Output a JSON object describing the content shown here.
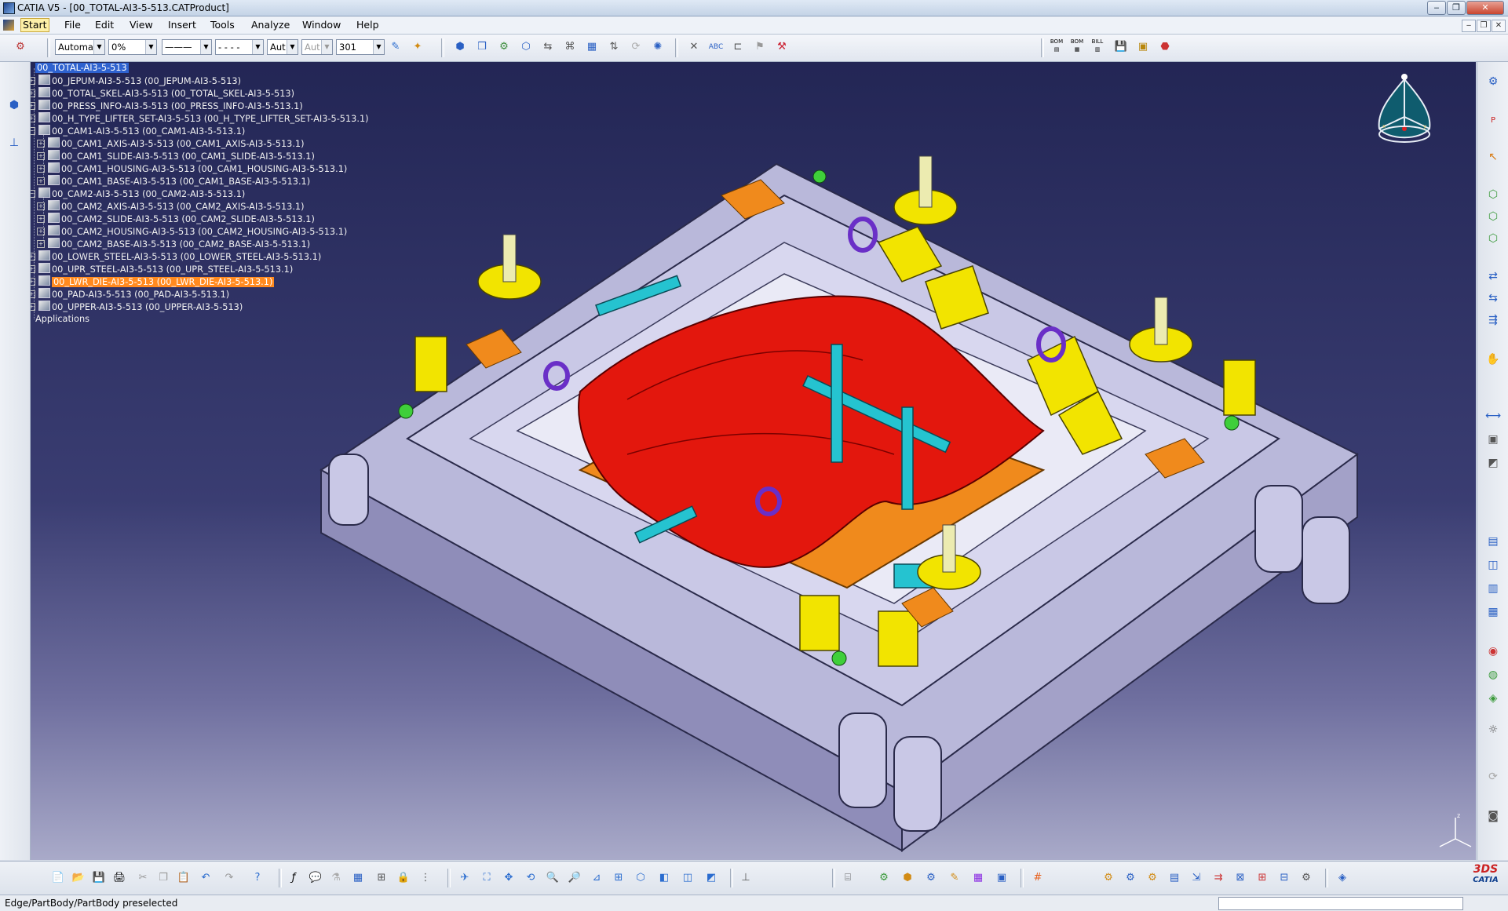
{
  "window": {
    "title": "CATIA V5 - [00_TOTAL-AI3-5-513.CATProduct]",
    "controls": [
      "‒",
      "❐",
      "✕"
    ],
    "mdi_controls": [
      "‒",
      "❐",
      "✕"
    ]
  },
  "menubar": {
    "items": [
      "Start",
      "File",
      "Edit",
      "View",
      "Insert",
      "Tools",
      "Analyze",
      "Window",
      "Help"
    ]
  },
  "toolbar": {
    "combo_color": "Automa",
    "combo_transparency": "0%",
    "combo_linetype": "———",
    "combo_lineweight": "- - - -",
    "combo_layer": "Aut",
    "combo_layer2": "Aut",
    "combo_number": "301",
    "group_labels": [
      "BOM",
      "BOM",
      "BILL"
    ]
  },
  "tree": {
    "nodes": [
      {
        "label": "00_TOTAL-AI3-5-513",
        "level": 0,
        "state": "root"
      },
      {
        "label": "00_JEPUM-AI3-5-513 (00_JEPUM-AI3-5-513)",
        "level": 1,
        "state": ""
      },
      {
        "label": "00_TOTAL_SKEL-AI3-5-513 (00_TOTAL_SKEL-AI3-5-513)",
        "level": 1,
        "state": ""
      },
      {
        "label": "00_PRESS_INFO-AI3-5-513 (00_PRESS_INFO-AI3-5-513.1)",
        "level": 1,
        "state": ""
      },
      {
        "label": "00_H_TYPE_LIFTER_SET-AI3-5-513 (00_H_TYPE_LIFTER_SET-AI3-5-513.1)",
        "level": 1,
        "state": ""
      },
      {
        "label": "00_CAM1-AI3-5-513 (00_CAM1-AI3-5-513.1)",
        "level": 1,
        "state": "open"
      },
      {
        "label": "00_CAM1_AXIS-AI3-5-513 (00_CAM1_AXIS-AI3-5-513.1)",
        "level": 2,
        "state": ""
      },
      {
        "label": "00_CAM1_SLIDE-AI3-5-513 (00_CAM1_SLIDE-AI3-5-513.1)",
        "level": 2,
        "state": ""
      },
      {
        "label": "00_CAM1_HOUSING-AI3-5-513 (00_CAM1_HOUSING-AI3-5-513.1)",
        "level": 2,
        "state": ""
      },
      {
        "label": "00_CAM1_BASE-AI3-5-513 (00_CAM1_BASE-AI3-5-513.1)",
        "level": 2,
        "state": ""
      },
      {
        "label": "00_CAM2-AI3-5-513 (00_CAM2-AI3-5-513.1)",
        "level": 1,
        "state": "open"
      },
      {
        "label": "00_CAM2_AXIS-AI3-5-513 (00_CAM2_AXIS-AI3-5-513.1)",
        "level": 2,
        "state": ""
      },
      {
        "label": "00_CAM2_SLIDE-AI3-5-513 (00_CAM2_SLIDE-AI3-5-513.1)",
        "level": 2,
        "state": ""
      },
      {
        "label": "00_CAM2_HOUSING-AI3-5-513 (00_CAM2_HOUSING-AI3-5-513.1)",
        "level": 2,
        "state": ""
      },
      {
        "label": "00_CAM2_BASE-AI3-5-513 (00_CAM2_BASE-AI3-5-513.1)",
        "level": 2,
        "state": ""
      },
      {
        "label": "00_LOWER_STEEL-AI3-5-513 (00_LOWER_STEEL-AI3-5-513.1)",
        "level": 1,
        "state": ""
      },
      {
        "label": "00_UPR_STEEL-AI3-5-513 (00_UPR_STEEL-AI3-5-513.1)",
        "level": 1,
        "state": ""
      },
      {
        "label": "00_LWR_DIE-AI3-5-513 (00_LWR_DIE-AI3-5-513.1)",
        "level": 1,
        "state": "highlighted"
      },
      {
        "label": "00_PAD-AI3-5-513 (00_PAD-AI3-5-513.1)",
        "level": 1,
        "state": ""
      },
      {
        "label": "00_UPPER-AI3-5-513 (00_UPPER-AI3-5-513)",
        "level": 1,
        "state": ""
      },
      {
        "label": "Applications",
        "level": 0,
        "state": "leaf"
      }
    ]
  },
  "statusbar": {
    "text": "Edge/PartBody/PartBody preselected"
  },
  "colors": {
    "viewport_top": "#232655",
    "viewport_bottom": "#a9aac9",
    "die_body": "#c9c8e6",
    "panel_red": "#e3170d",
    "accent_yellow": "#f2e400",
    "accent_cyan": "#25c3d0",
    "accent_orange": "#f08a1c",
    "selection": "#2e62cf",
    "highlight": "#ff8a1f"
  },
  "compass_axes": [
    "x",
    "y",
    "z"
  ],
  "logo_text": "CATIA"
}
